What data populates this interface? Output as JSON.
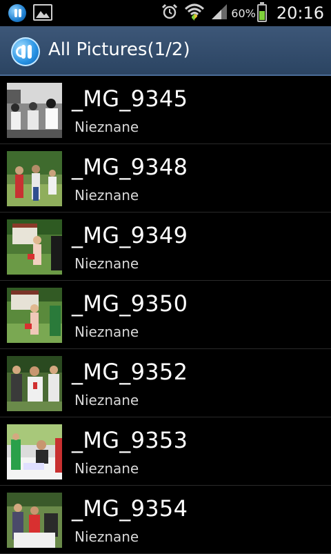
{
  "status_bar": {
    "battery_percent": "60%",
    "time": "20:16",
    "icons": [
      "app-notification-icon",
      "gallery-notification-icon",
      "alarm-icon",
      "wifi-icon",
      "signal-icon",
      "battery-icon"
    ]
  },
  "action_bar": {
    "title": "All Pictures(1/2)",
    "logo_icon": "app-logo-icon"
  },
  "colors": {
    "action_bar": "#2f4a6b",
    "background": "#000000",
    "subtitle": "#d8d8d8"
  },
  "items": [
    {
      "title": "_MG_9345",
      "subtitle": "Nieznane"
    },
    {
      "title": "_MG_9348",
      "subtitle": "Nieznane"
    },
    {
      "title": "_MG_9349",
      "subtitle": "Nieznane"
    },
    {
      "title": "_MG_9350",
      "subtitle": "Nieznane"
    },
    {
      "title": "_MG_9352",
      "subtitle": "Nieznane"
    },
    {
      "title": "_MG_9353",
      "subtitle": "Nieznane"
    },
    {
      "title": "_MG_9354",
      "subtitle": "Nieznane"
    }
  ]
}
